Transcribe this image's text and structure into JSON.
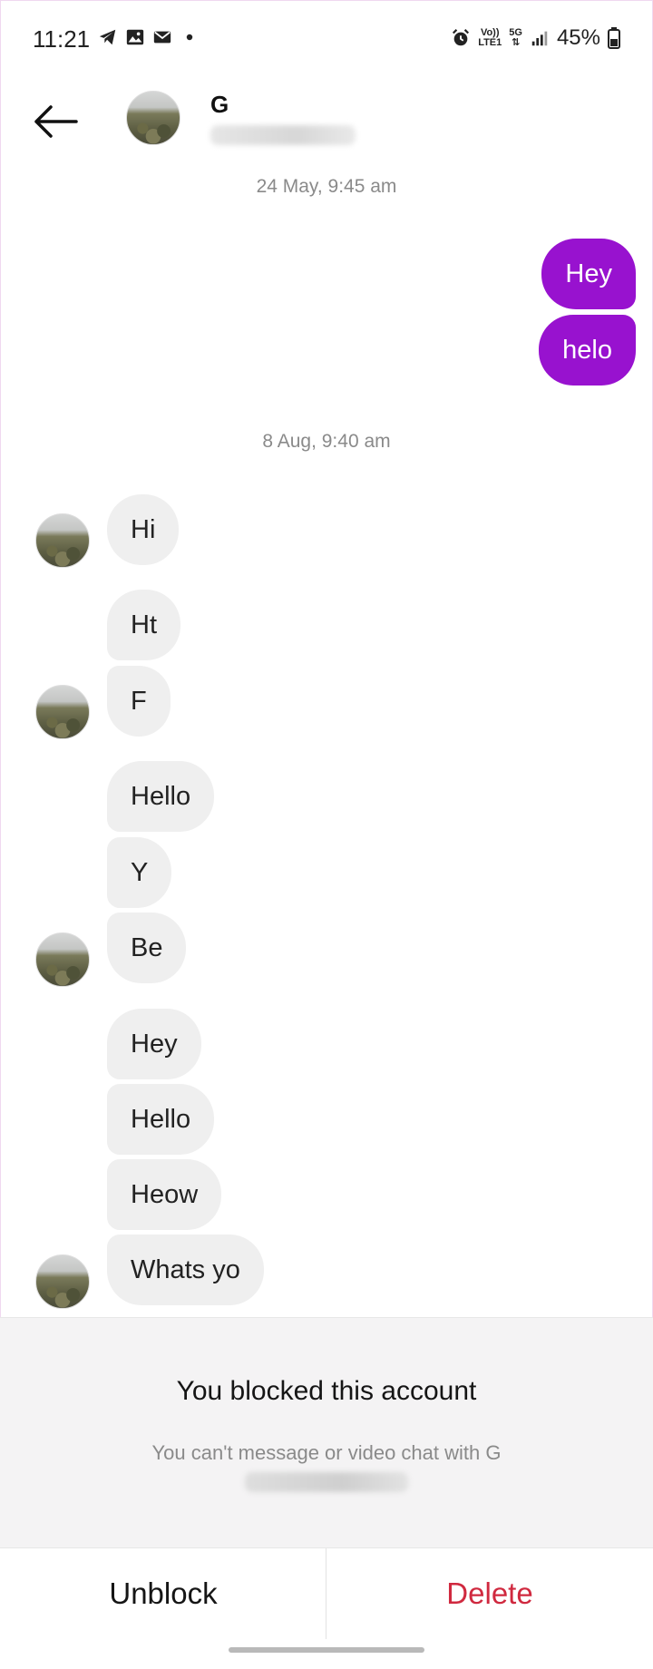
{
  "status_bar": {
    "time": "11:21",
    "left_icons": [
      "telegram-icon",
      "gallery-icon",
      "mail-icon",
      "dot-icon"
    ],
    "volte_label_top": "Vo))",
    "volte_label_bottom": "LTE1",
    "network_label": "5G",
    "battery": "45%"
  },
  "header": {
    "contact_name": "G"
  },
  "thread": {
    "timestamp_1": "24 May, 9:45 am",
    "timestamp_2": "8 Aug, 9:40 am",
    "outgoing": [
      "Hey",
      "helo"
    ],
    "incoming": [
      "Hi",
      "Ht",
      "F",
      "Hello",
      "Y",
      "Be",
      "Hey",
      "Hello",
      "Heow",
      "Whats yo"
    ]
  },
  "blocked": {
    "title": "You blocked this account",
    "subtitle": "You can't message or video chat with G"
  },
  "actions": {
    "unblock": "Unblock",
    "delete": "Delete"
  },
  "colors": {
    "outgoing_bubble": "#9812cf",
    "incoming_bubble": "#efefef",
    "delete": "#d0293f"
  }
}
